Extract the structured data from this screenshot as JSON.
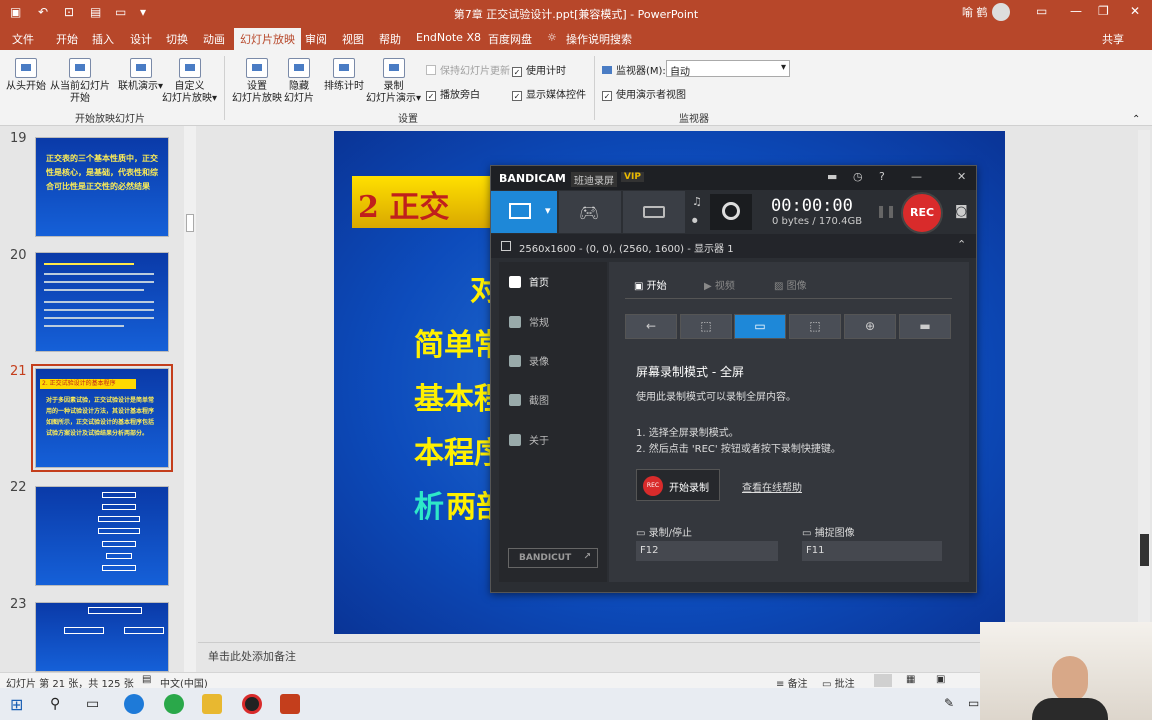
{
  "titlebar": {
    "title": "第7章 正交试验设计.ppt[兼容模式] - PowerPoint",
    "user": "喻 鹤"
  },
  "tabs": [
    "文件",
    "开始",
    "插入",
    "设计",
    "切换",
    "动画",
    "幻灯片放映",
    "审阅",
    "视图",
    "帮助",
    "EndNote X8",
    "百度网盘",
    "操作说明搜索",
    "共享"
  ],
  "ribbon": {
    "b1": "从头开始",
    "b2a": "从当前幻灯片",
    "b2b": "开始",
    "b3a": "联机演示",
    "b4a": "自定义",
    "b4b": "幻灯片放映",
    "g1": "开始放映幻灯片",
    "b5a": "设置",
    "b5b": "幻灯片放映",
    "b6a": "隐藏",
    "b6b": "幻灯片",
    "b7": "排练计时",
    "b8a": "录制",
    "b8b": "幻灯片演示",
    "c1": "保持幻灯片更新",
    "c2": "播放旁白",
    "c3": "使用计时",
    "c4": "显示媒体控件",
    "g2": "设置",
    "monitor_label": "监视器(M):",
    "monitor_value": "自动",
    "c5": "使用演示者视图",
    "g3": "监视器"
  },
  "thumbs": {
    "n19": "19",
    "t19": "正交表的三个基本性质中，正交性是核心，是基础，代表性和综合可比性是正交性的必然结果",
    "n20": "20",
    "n21": "21",
    "n22": "22",
    "n23": "23",
    "t21a": "2. 正交试验设计的基本程序",
    "t21b": "对于多因素试验，正交试验设计是简单常用的一种试验设计方法，其设计基本程序如图所示，正交试验设计的基本程序包括试验方案设计及试验结果分析两部分。"
  },
  "slide": {
    "title": "2  正交",
    "l1": "对",
    "l2": "简单常",
    "l3": "基本程",
    "l4": "本程序",
    "l5a": "析",
    "l5b": "两部"
  },
  "notes": "单击此处添加备注",
  "status": {
    "slide": "幻灯片 第 21 张，共 125 张",
    "lang": "中文(中国)",
    "notes": "备注",
    "comments": "批注"
  },
  "bandicam": {
    "brand": "BANDICAM",
    "edition": "班迪录屏",
    "vip": "VIP",
    "timer": "00:00:00",
    "size": "0 bytes / 170.4GB",
    "rec": "REC",
    "res": "2560x1600 - (0, 0), (2560, 1600) - 显示器 1",
    "nav": [
      "首页",
      "常规",
      "录像",
      "截图",
      "关于"
    ],
    "tabs": [
      "开始",
      "视频",
      "图像"
    ],
    "mode_title": "屏幕录制模式 - 全屏",
    "mode_desc": "使用此录制模式可以录制全屏内容。",
    "step1": "1. 选择全屏录制模式。",
    "step2": "2. 然后点击 'REC' 按钮或者按下录制快捷键。",
    "start_btn": "开始录制",
    "help_link": "查看在线帮助",
    "hk1_label": "录制/停止",
    "hk1_value": "F12",
    "hk2_label": "捕捉图像",
    "hk2_value": "F11",
    "bandicut": "BANDICUT"
  }
}
